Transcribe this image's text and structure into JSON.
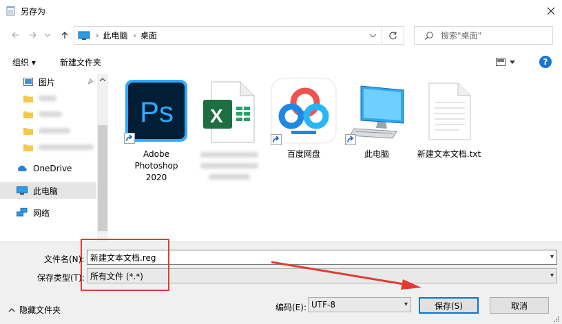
{
  "window": {
    "title": "另存为"
  },
  "address": {
    "crumbs": [
      "此电脑",
      "桌面"
    ],
    "search_placeholder": "搜索\"桌面\""
  },
  "toolbar": {
    "organize": "组织 ▾",
    "new_folder": "新建文件夹"
  },
  "sidebar": {
    "items": [
      {
        "label": "图片"
      },
      {
        "label": "OneDrive"
      },
      {
        "label": "此电脑"
      },
      {
        "label": "网络"
      }
    ]
  },
  "files": [
    {
      "label": "Adobe Photoshop 2020",
      "lines": [
        "Adobe",
        "Photoshop",
        "2020"
      ]
    },
    {
      "label": ""
    },
    {
      "label": "百度网盘"
    },
    {
      "label": "此电脑"
    },
    {
      "label": "新建文本文档.txt"
    }
  ],
  "save_form": {
    "filename_label": "文件名(N):",
    "filename_value": "新建文本文档.reg",
    "filetype_label": "保存类型(T):",
    "filetype_value": "所有文件  (*.*)",
    "hide_folders": "隐藏文件夹",
    "encoding_label": "编码(E):",
    "encoding_value": "UTF-8",
    "save_button": "保存(S)",
    "cancel_button": "取消"
  },
  "colors": {
    "accent": "#0078d7",
    "annotation": "#e03c31"
  }
}
